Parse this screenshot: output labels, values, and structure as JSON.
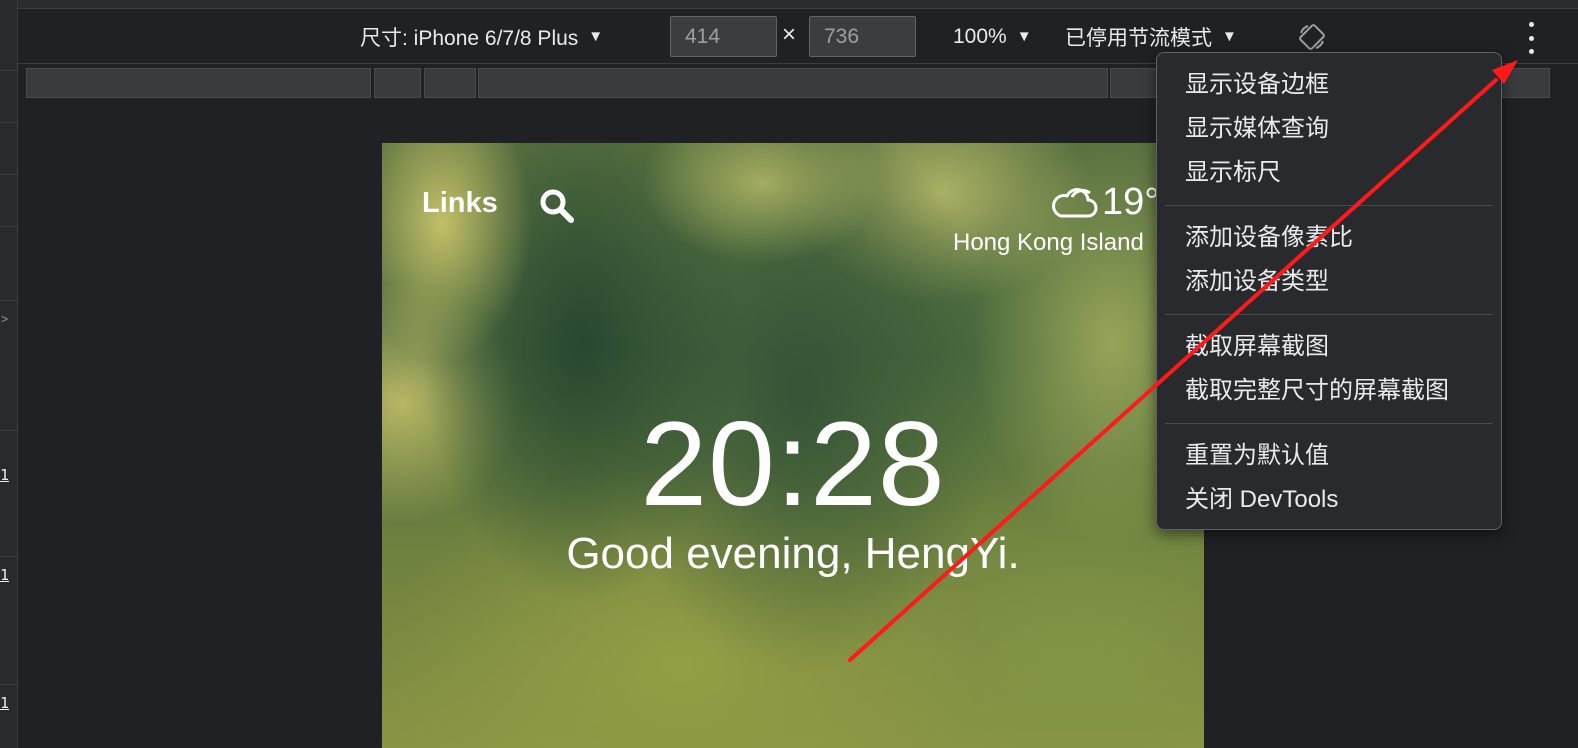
{
  "toolbar": {
    "device_label": "尺寸: iPhone 6/7/8 Plus",
    "width_value": "414",
    "times_symbol": "×",
    "height_value": "736",
    "zoom_label": "100%",
    "throttle_label": "已停用节流模式",
    "caret": "▼"
  },
  "left_strip": {
    "arrow": ">",
    "marks": [
      "1",
      "1",
      "1"
    ]
  },
  "page": {
    "links_label": "Links",
    "temperature": "19°",
    "location": "Hong Kong Island",
    "time": "20:28",
    "greeting": "Good evening, HengYi."
  },
  "menu": {
    "items": [
      "显示设备边框",
      "显示媒体查询",
      "显示标尺",
      "添加设备像素比",
      "添加设备类型",
      "截取屏幕截图",
      "截取完整尺寸的屏幕截图",
      "重置为默认值",
      "关闭 DevTools"
    ]
  },
  "colors": {
    "background": "#202124",
    "menu_background": "#292a2d",
    "annotation_arrow": "#ff1a1a"
  },
  "icons": [
    "search-icon",
    "cloud-icon",
    "rotate-icon",
    "more-options-icon",
    "dropdown-caret-icon"
  ]
}
